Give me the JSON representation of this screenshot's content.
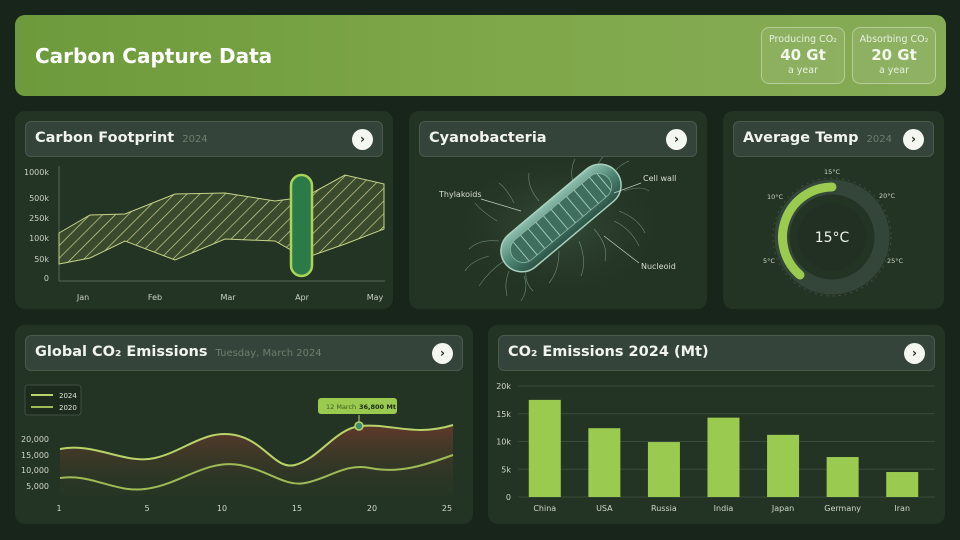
{
  "header": {
    "title": "Carbon Capture Data",
    "stats": [
      {
        "label": "Producing CO₂",
        "value": "40 Gt",
        "sub": "a year"
      },
      {
        "label": "Absorbing CO₂",
        "value": "20 Gt",
        "sub": "a year"
      }
    ]
  },
  "footprint": {
    "title": "Carbon Footprint",
    "year": "2024",
    "arrow": "›",
    "chart_data": {
      "type": "area",
      "categories": [
        "Jan",
        "Feb",
        "Mar",
        "Apr",
        "May"
      ],
      "y_ticks": [
        "1000k",
        "500k",
        "250k",
        "100k",
        "50k",
        "0"
      ],
      "highlight": "Apr"
    }
  },
  "cyano": {
    "title": "Cyanobacteria",
    "arrow": "›",
    "labels": {
      "thylakoids": "Thylakoids",
      "cell_wall": "Cell wall",
      "nucleoid": "Nucleoid"
    }
  },
  "temp": {
    "title": "Average Temp",
    "year": "2024",
    "arrow": "›",
    "value": "15°C",
    "ticks": {
      "t5": "5°C",
      "t10": "10°C",
      "t15": "15°C",
      "t20": "20°C",
      "t25": "25°C"
    }
  },
  "global": {
    "title": "Global CO₂ Emissions",
    "date": "Tuesday, March 2024",
    "arrow": "›",
    "tooltip": {
      "date": "12 March",
      "value": "36,800 Mt"
    },
    "chart_data": {
      "type": "line",
      "series": [
        {
          "name": "2024",
          "color": "#b9d36a"
        },
        {
          "name": "2020",
          "color": "#9ebb55"
        }
      ],
      "x_ticks": [
        "1",
        "5",
        "10",
        "15",
        "20",
        "25"
      ],
      "y_ticks": [
        "20,000",
        "15,000",
        "10,000",
        "5,000"
      ]
    }
  },
  "emissions": {
    "title": "CO₂ Emissions 2024 (Mt)",
    "arrow": "›",
    "chart_data": {
      "type": "bar",
      "categories": [
        "China",
        "USA",
        "Russia",
        "India",
        "Japan",
        "Germany",
        "Iran"
      ],
      "values": [
        17500,
        12400,
        9900,
        14300,
        11200,
        7200,
        4500
      ],
      "y_ticks": [
        "20k",
        "15k",
        "10k",
        "5k",
        "0"
      ],
      "ylim": [
        0,
        20000
      ],
      "bar_color": "#9acb50"
    }
  }
}
